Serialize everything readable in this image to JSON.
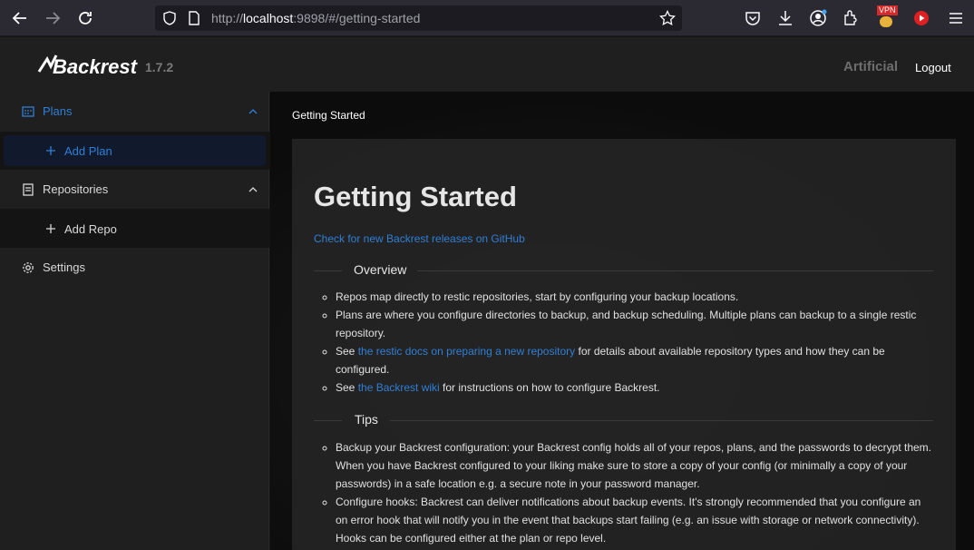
{
  "browser": {
    "url_prefix": "http://",
    "url_host": "localhost",
    "url_rest": ":9898/#/getting-started",
    "vpn_badge": "VPN"
  },
  "header": {
    "logo_text": "Backrest",
    "version": "1.7.2",
    "instance_name": "Artificial",
    "logout_label": "Logout"
  },
  "sidebar": {
    "plans_label": "Plans",
    "add_plan_label": "Add Plan",
    "repositories_label": "Repositories",
    "add_repo_label": "Add Repo",
    "settings_label": "Settings"
  },
  "main": {
    "breadcrumb": "Getting Started",
    "title": "Getting Started",
    "releases_link": "Check for new Backrest releases on GitHub",
    "overview": {
      "heading": "Overview",
      "items": [
        {
          "text": "Repos map directly to restic repositories, start by configuring your backup locations."
        },
        {
          "text": "Plans are where you configure directories to backup, and backup scheduling. Multiple plans can backup to a single restic repository."
        },
        {
          "prefix": "See ",
          "link": "the restic docs on preparing a new repository",
          "suffix": " for details about available repository types and how they can be configured."
        },
        {
          "prefix": "See ",
          "link": "the Backrest wiki",
          "suffix": " for instructions on how to configure Backrest."
        }
      ]
    },
    "tips": {
      "heading": "Tips",
      "items": [
        {
          "text": "Backup your Backrest configuration: your Backrest config holds all of your repos, plans, and the passwords to decrypt them. When you have Backrest configured to your liking make sure to store a copy of your config (or minimally a copy of your passwords) in a safe location e.g. a secure note in your password manager."
        },
        {
          "text": "Configure hooks: Backrest can deliver notifications about backup events. It's strongly recommended that you configure an on error hook that will notify you in the event that backups start failing (e.g. an issue with storage or network connectivity). Hooks can be configured either at the plan or repo level."
        }
      ]
    }
  },
  "colors": {
    "accent": "#2f7fd8",
    "sidebar_bg": "#1f1f1f",
    "card_bg": "#262626"
  }
}
